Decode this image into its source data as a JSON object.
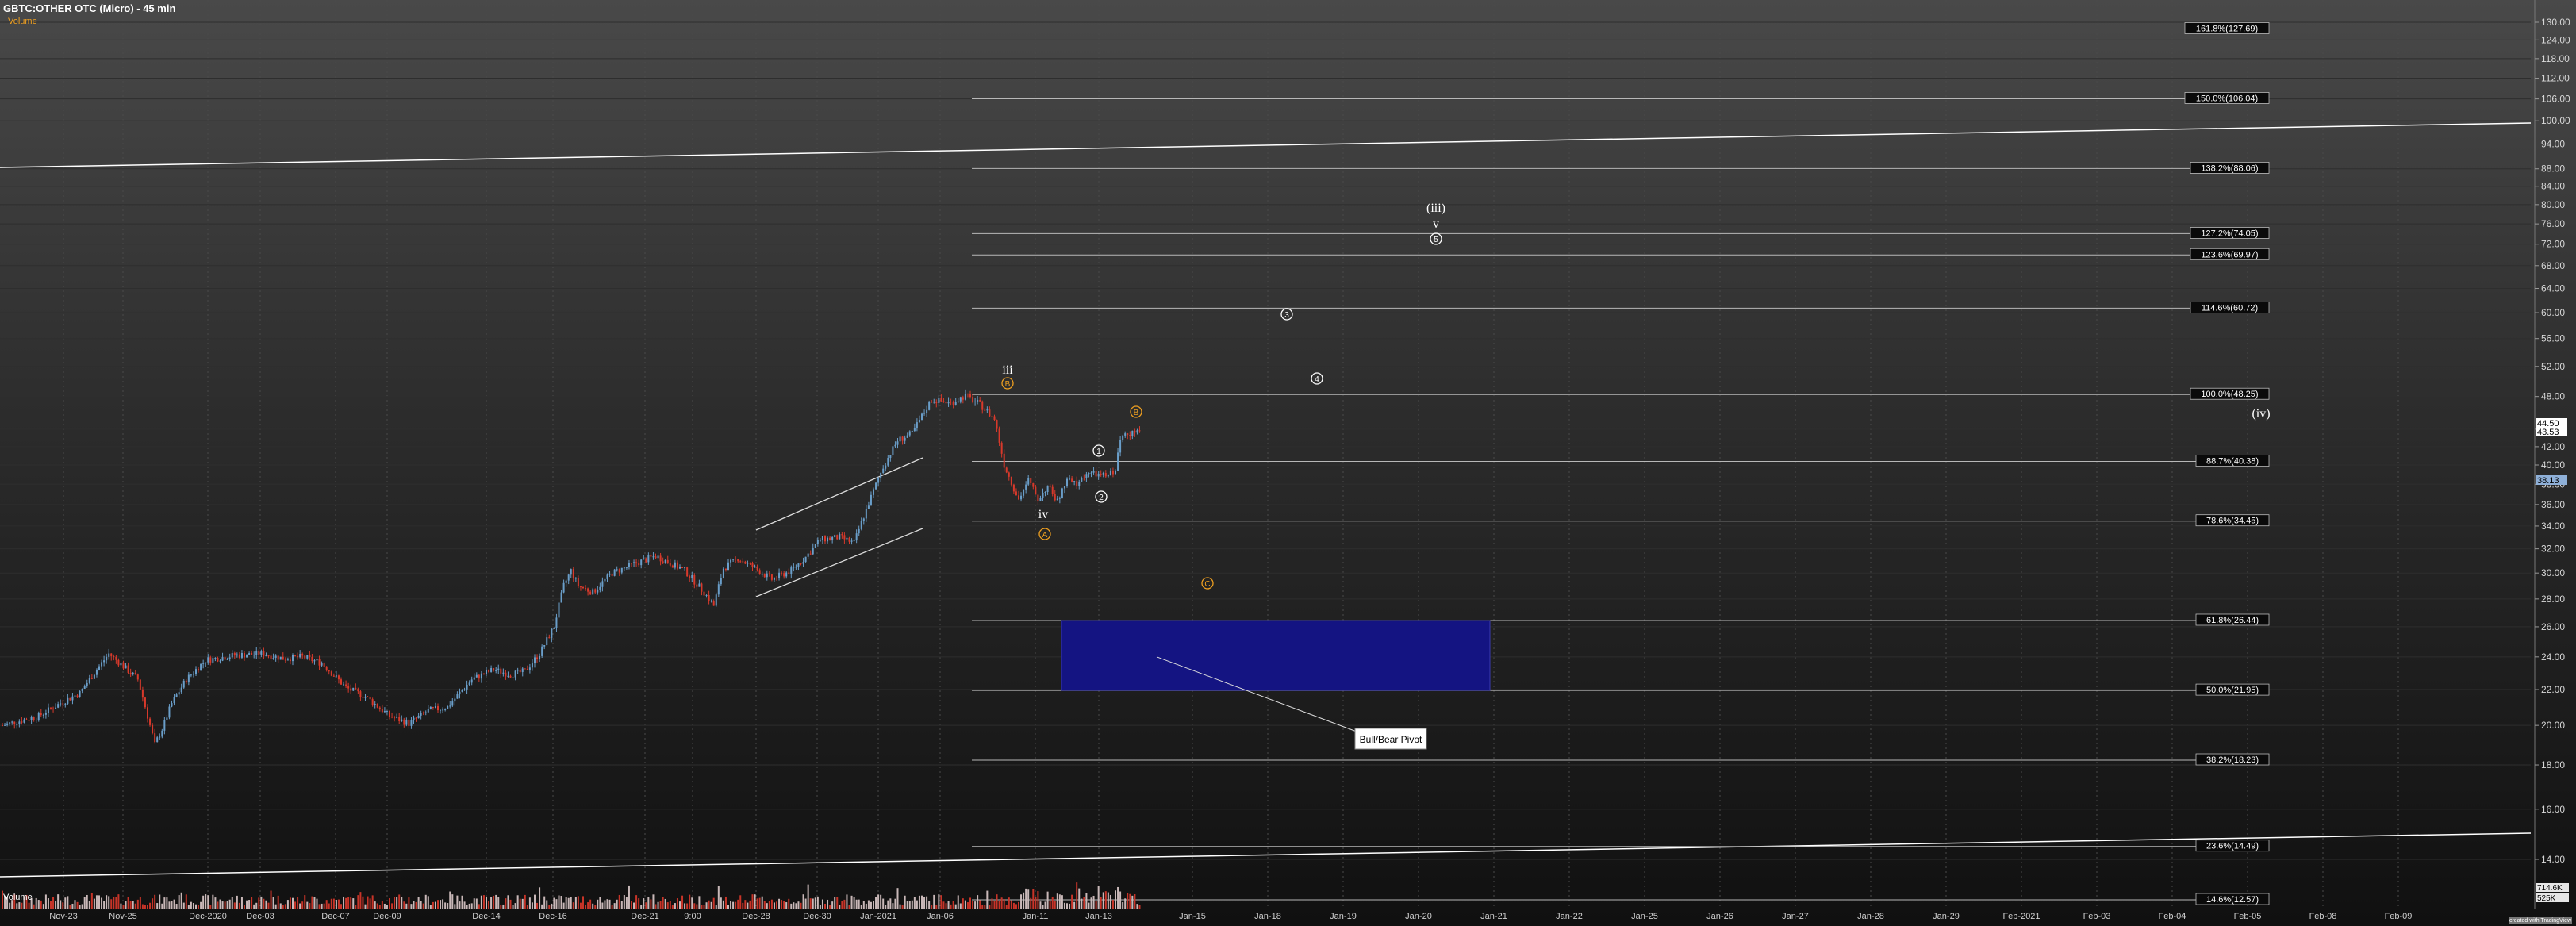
{
  "header": {
    "title": "GBTC:OTHER OTC (Micro) - 45 min",
    "subtitle": "Volume"
  },
  "volume_label": "Volume",
  "attribution_badge": "created with TradingView",
  "colors": {
    "up": "#6a9ec9",
    "down": "#d8392b",
    "fib_line": "#b8b8b8",
    "trend_line": "#ffffff",
    "wave_orange": "#f0a020",
    "wave_white": "#ffffff",
    "target_box": "#141482",
    "volume_up": "#c9b8b8",
    "volume_down": "#c83428"
  },
  "chart_data": {
    "type": "candlestick",
    "price_axis": {
      "scale": "log",
      "ticks": [
        130,
        124,
        118,
        112,
        106,
        100,
        94,
        88,
        84,
        80,
        76,
        72,
        68,
        64,
        60,
        56,
        52,
        48,
        44,
        42,
        40,
        38,
        36,
        34,
        32,
        30,
        28,
        26,
        24,
        22,
        20,
        18,
        16,
        14
      ],
      "last_price_labels": [
        "44.50",
        "43.53",
        "38.13"
      ]
    },
    "volume_axis": {
      "labels": [
        "714.6K",
        "525K"
      ]
    },
    "time_axis": [
      "Nov-23",
      "Nov-25",
      "Dec-2020",
      "Dec-03",
      "Dec-07",
      "Dec-09",
      "Dec-14",
      "Dec-16",
      "Dec-21",
      "9:00",
      "Dec-28",
      "Dec-30",
      "Jan-2021",
      "Jan-06",
      "Jan-11",
      "Jan-13",
      "Jan-15",
      "Jan-18",
      "Jan-19",
      "Jan-20",
      "Jan-21",
      "Jan-22",
      "Jan-25",
      "Jan-26",
      "Jan-27",
      "Jan-28",
      "Jan-29",
      "Feb-2021",
      "Feb-03",
      "Feb-04",
      "Feb-05",
      "Feb-08",
      "Feb-09"
    ],
    "price_path": [
      [
        0,
        20.0
      ],
      [
        15,
        20.5
      ],
      [
        25,
        21.3
      ],
      [
        32,
        21.8
      ],
      [
        38,
        23.0
      ],
      [
        44,
        24.2
      ],
      [
        50,
        23.4
      ],
      [
        56,
        22.6
      ],
      [
        60,
        20.5
      ],
      [
        63,
        19.0
      ],
      [
        66,
        19.8
      ],
      [
        70,
        21.2
      ],
      [
        76,
        22.6
      ],
      [
        84,
        23.8
      ],
      [
        96,
        24.1
      ],
      [
        108,
        24.2
      ],
      [
        116,
        23.9
      ],
      [
        124,
        24.0
      ],
      [
        132,
        23.6
      ],
      [
        142,
        22.1
      ],
      [
        150,
        21.6
      ],
      [
        160,
        20.5
      ],
      [
        168,
        20.1
      ],
      [
        176,
        20.8
      ],
      [
        184,
        21.0
      ],
      [
        194,
        22.6
      ],
      [
        203,
        23.2
      ],
      [
        210,
        22.9
      ],
      [
        216,
        23.1
      ],
      [
        222,
        24.2
      ],
      [
        228,
        26.0
      ],
      [
        232,
        29.0
      ],
      [
        235,
        30.2
      ],
      [
        238,
        29.0
      ],
      [
        244,
        28.5
      ],
      [
        252,
        30.0
      ],
      [
        262,
        30.8
      ],
      [
        270,
        31.4
      ],
      [
        276,
        30.8
      ],
      [
        282,
        30.2
      ],
      [
        290,
        28.5
      ],
      [
        294,
        27.5
      ],
      [
        298,
        30.4
      ],
      [
        304,
        31.2
      ],
      [
        310,
        30.5
      ],
      [
        318,
        29.5
      ],
      [
        326,
        30.2
      ],
      [
        332,
        31.3
      ],
      [
        338,
        32.8
      ],
      [
        346,
        33.0
      ],
      [
        352,
        32.5
      ],
      [
        358,
        36.1
      ],
      [
        364,
        39.8
      ],
      [
        370,
        42.7
      ],
      [
        376,
        43.5
      ],
      [
        384,
        47.6
      ],
      [
        392,
        47.2
      ],
      [
        398,
        48.1
      ],
      [
        404,
        47.0
      ],
      [
        410,
        45.2
      ],
      [
        414,
        40.0
      ],
      [
        418,
        37.6
      ],
      [
        420,
        36.5
      ],
      [
        424,
        38.4
      ],
      [
        428,
        36.5
      ],
      [
        432,
        37.8
      ],
      [
        436,
        36.3
      ],
      [
        440,
        38.4
      ],
      [
        444,
        38.0
      ],
      [
        446,
        38.5
      ],
      [
        448,
        39.2
      ],
      [
        452,
        39.0
      ],
      [
        456,
        38.8
      ],
      [
        460,
        39.5
      ],
      [
        462,
        42.7
      ],
      [
        464,
        43.8
      ],
      [
        466,
        43.6
      ],
      [
        470,
        43.5
      ]
    ],
    "fib_levels": [
      {
        "label": "161.8%(127.69)",
        "value": 127.69
      },
      {
        "label": "150.0%(106.04)",
        "value": 106.04
      },
      {
        "label": "138.2%(88.06)",
        "value": 88.06
      },
      {
        "label": "127.2%(74.05)",
        "value": 74.05
      },
      {
        "label": "123.6%(69.97)",
        "value": 69.97
      },
      {
        "label": "114.6%(60.72)",
        "value": 60.72
      },
      {
        "label": "100.0%(48.25)",
        "value": 48.25
      },
      {
        "label": "88.7%(40.38)",
        "value": 40.38
      },
      {
        "label": "78.6%(34.45)",
        "value": 34.45
      },
      {
        "label": "61.8%(26.44)",
        "value": 26.44
      },
      {
        "label": "50.0%(21.95)",
        "value": 21.95
      },
      {
        "label": "38.2%(18.23)",
        "value": 18.23
      },
      {
        "label": "23.6%(14.49)",
        "value": 14.49
      },
      {
        "label": "14.6%(12.57)",
        "value": 12.57
      }
    ],
    "wave_labels": [
      {
        "text": "iii",
        "color": "white",
        "style": "roman"
      },
      {
        "text": "B",
        "color": "orange",
        "style": "circle"
      },
      {
        "text": "iv",
        "color": "white",
        "style": "roman"
      },
      {
        "text": "A",
        "color": "orange",
        "style": "circle"
      },
      {
        "text": "C",
        "color": "orange",
        "style": "circle"
      },
      {
        "text": "B",
        "color": "orange",
        "style": "circle"
      },
      {
        "text": "1",
        "color": "white",
        "style": "circle"
      },
      {
        "text": "2",
        "color": "white",
        "style": "circle"
      },
      {
        "text": "3",
        "color": "white",
        "style": "circle"
      },
      {
        "text": "4",
        "color": "white",
        "style": "circle"
      },
      {
        "text": "(iii)",
        "color": "white",
        "style": "roman"
      },
      {
        "text": "v",
        "color": "white",
        "style": "roman"
      },
      {
        "text": "5",
        "color": "white",
        "style": "circle"
      },
      {
        "text": "(iv)",
        "color": "white",
        "style": "roman"
      }
    ],
    "pivot_zone": {
      "label": "Bull/Bear Pivot",
      "low": 21.95,
      "high": 26.44
    },
    "grid": true
  }
}
